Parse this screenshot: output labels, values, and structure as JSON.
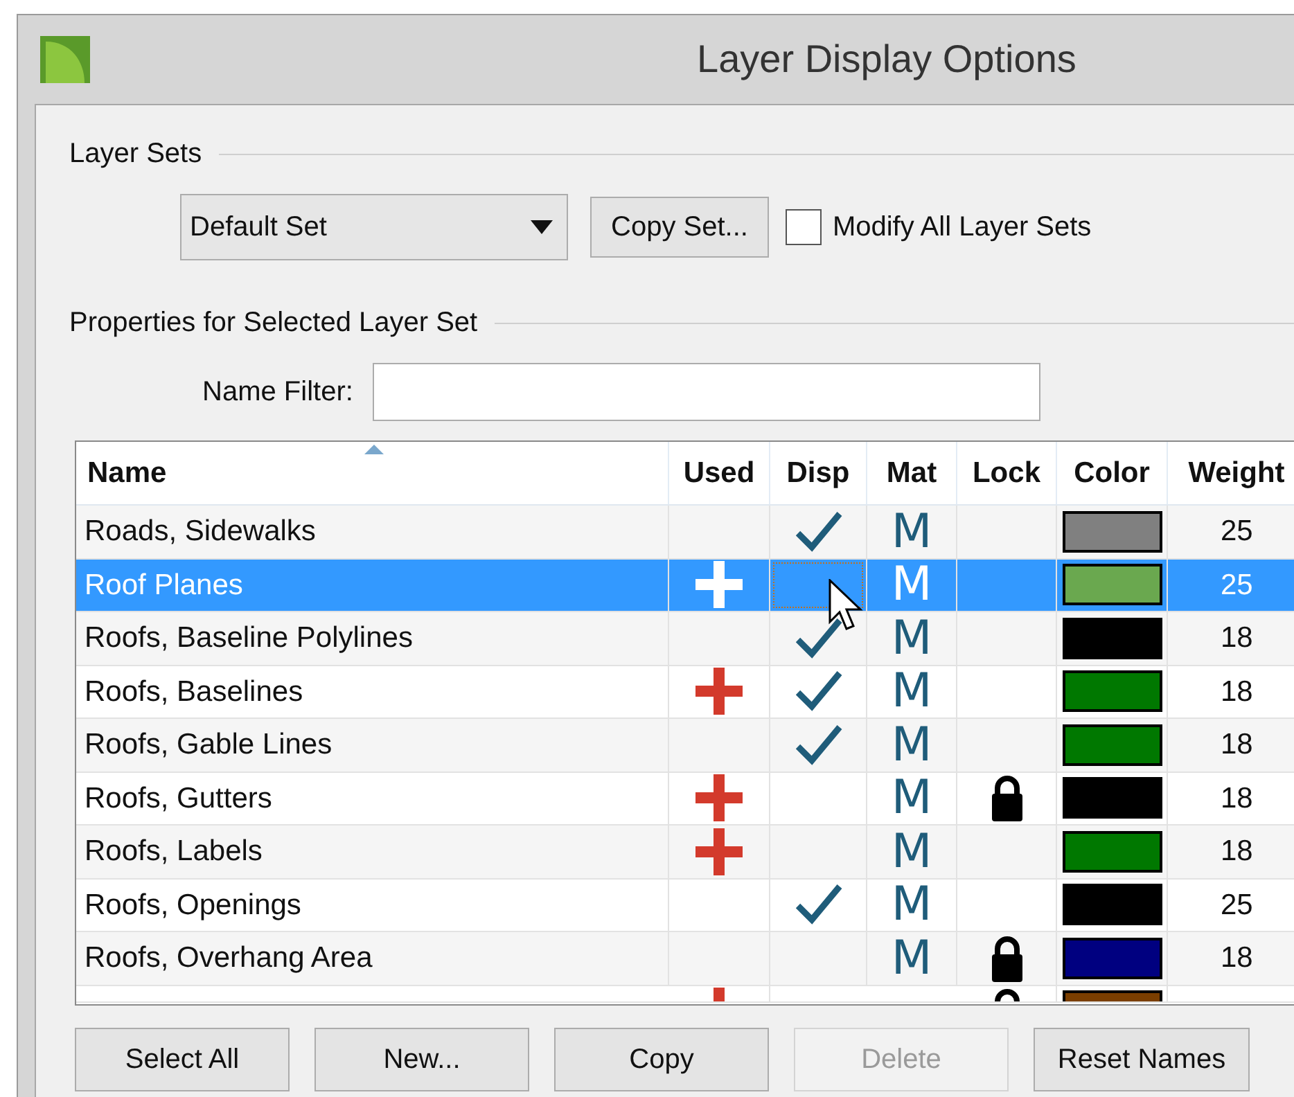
{
  "window": {
    "title": "Layer Display Options"
  },
  "layer_sets": {
    "legend": "Layer Sets",
    "dropdown": "Default Set",
    "copy_button": "Copy Set...",
    "modify_all": {
      "label": "Modify All Layer Sets",
      "checked": false
    }
  },
  "properties": {
    "legend": "Properties for Selected Layer Set",
    "name_filter_label": "Name Filter:"
  },
  "table": {
    "columns": [
      "Name",
      "Used",
      "Disp",
      "Mat",
      "Lock",
      "Color",
      "Weight"
    ],
    "rows": [
      {
        "name": "Roads, Sidewalks",
        "used": false,
        "disp": true,
        "mat": "M",
        "lock": false,
        "color": "#808080",
        "weight": "25",
        "selected": false
      },
      {
        "name": "Roof Planes",
        "used": true,
        "disp": false,
        "mat": "M",
        "lock": false,
        "color": "#6aa84f",
        "weight": "25",
        "selected": true
      },
      {
        "name": "Roofs, Baseline Polylines",
        "used": false,
        "disp": true,
        "mat": "M",
        "lock": false,
        "color": "#000000",
        "weight": "18",
        "selected": false
      },
      {
        "name": "Roofs, Baselines",
        "used": true,
        "disp": true,
        "mat": "M",
        "lock": false,
        "color": "#007800",
        "weight": "18",
        "selected": false
      },
      {
        "name": "Roofs, Gable Lines",
        "used": false,
        "disp": true,
        "mat": "M",
        "lock": false,
        "color": "#007800",
        "weight": "18",
        "selected": false
      },
      {
        "name": "Roofs, Gutters",
        "used": true,
        "disp": false,
        "mat": "M",
        "lock": true,
        "color": "#000000",
        "weight": "18",
        "selected": false
      },
      {
        "name": "Roofs, Labels",
        "used": true,
        "disp": false,
        "mat": "M",
        "lock": false,
        "color": "#007800",
        "weight": "18",
        "selected": false
      },
      {
        "name": "Roofs, Openings",
        "used": false,
        "disp": true,
        "mat": "M",
        "lock": false,
        "color": "#000000",
        "weight": "25",
        "selected": false
      },
      {
        "name": "Roofs, Overhang Area",
        "used": false,
        "disp": false,
        "mat": "M",
        "lock": true,
        "color": "#000080",
        "weight": "18",
        "selected": false
      },
      {
        "used": true,
        "disp": false,
        "lock": true,
        "color": "#7a3e00",
        "selected": false
      }
    ]
  },
  "buttons": [
    {
      "label": "Select All",
      "disabled": false
    },
    {
      "label": "New...",
      "disabled": false
    },
    {
      "label": "Copy",
      "disabled": false
    },
    {
      "label": "Delete",
      "disabled": true
    },
    {
      "label": "Reset Names",
      "disabled": false
    }
  ]
}
